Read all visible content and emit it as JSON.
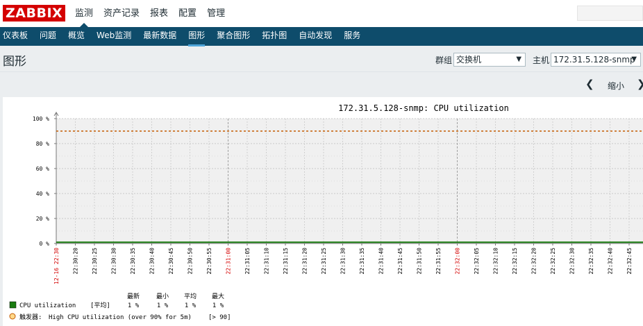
{
  "logo": "ZABBIX",
  "top_menu": [
    "监测",
    "资产记录",
    "报表",
    "配置",
    "管理"
  ],
  "sub_menu": [
    "仪表板",
    "问题",
    "概览",
    "Web监测",
    "最新数据",
    "图形",
    "聚合图形",
    "拓扑图",
    "自动发现",
    "服务"
  ],
  "page_title": "图形",
  "filter": {
    "group_label": "群组",
    "group_value": "交换机",
    "host_label": "主机",
    "host_value": "172.31.5.128-snmp"
  },
  "zoom_label": "缩小",
  "colors": {
    "brand": "#d40000",
    "nav_bg": "#0e4c6b",
    "series": "#1a7c11",
    "trigger": "#c35a00",
    "date_tick": "#d40000"
  },
  "chart_data": {
    "type": "line",
    "title": "172.31.5.128-snmp: CPU utilization",
    "y_ticks": [
      "0 %",
      "20 %",
      "40 %",
      "60 %",
      "80 %",
      "100 %"
    ],
    "ylim": [
      0,
      100
    ],
    "x_ticks": [
      "12-16 22:30",
      "22:30:20",
      "22:30:25",
      "22:30:30",
      "22:30:35",
      "22:30:40",
      "22:30:45",
      "22:30:50",
      "22:30:55",
      "22:31:00",
      "22:31:05",
      "22:31:10",
      "22:31:15",
      "22:31:20",
      "22:31:25",
      "22:31:30",
      "22:31:35",
      "22:31:40",
      "22:31:45",
      "22:31:50",
      "22:31:55",
      "22:32:00",
      "22:32:05",
      "22:32:10",
      "22:32:15",
      "22:32:20",
      "22:32:25",
      "22:32:30",
      "22:32:35",
      "22:32:40",
      "22:32:45"
    ],
    "x_major": [
      "12-16 22:30",
      "22:31:00",
      "22:32:00"
    ],
    "series": [
      {
        "name": "CPU utilization",
        "values": [
          1,
          1,
          1,
          1,
          1,
          1,
          1,
          1,
          1,
          1,
          1,
          1,
          1,
          1,
          1,
          1,
          1,
          1,
          1,
          1,
          1,
          1,
          1,
          1,
          1,
          1,
          1,
          1,
          1,
          1,
          1
        ]
      }
    ],
    "trigger": {
      "name": "High CPU utilization (over 90% for 5m)",
      "value": 90
    },
    "grid": true
  },
  "legend": {
    "headers": [
      "最新",
      "最小",
      "平均",
      "最大"
    ],
    "series_label": "CPU utilization",
    "func_label": "[平均]",
    "stats": [
      "1 %",
      "1 %",
      "1 %",
      "1 %"
    ],
    "trigger_prefix": "触发器:",
    "trigger_text": "High CPU utilization (over 90% for 5m)",
    "trigger_cond": "[> 90]"
  }
}
